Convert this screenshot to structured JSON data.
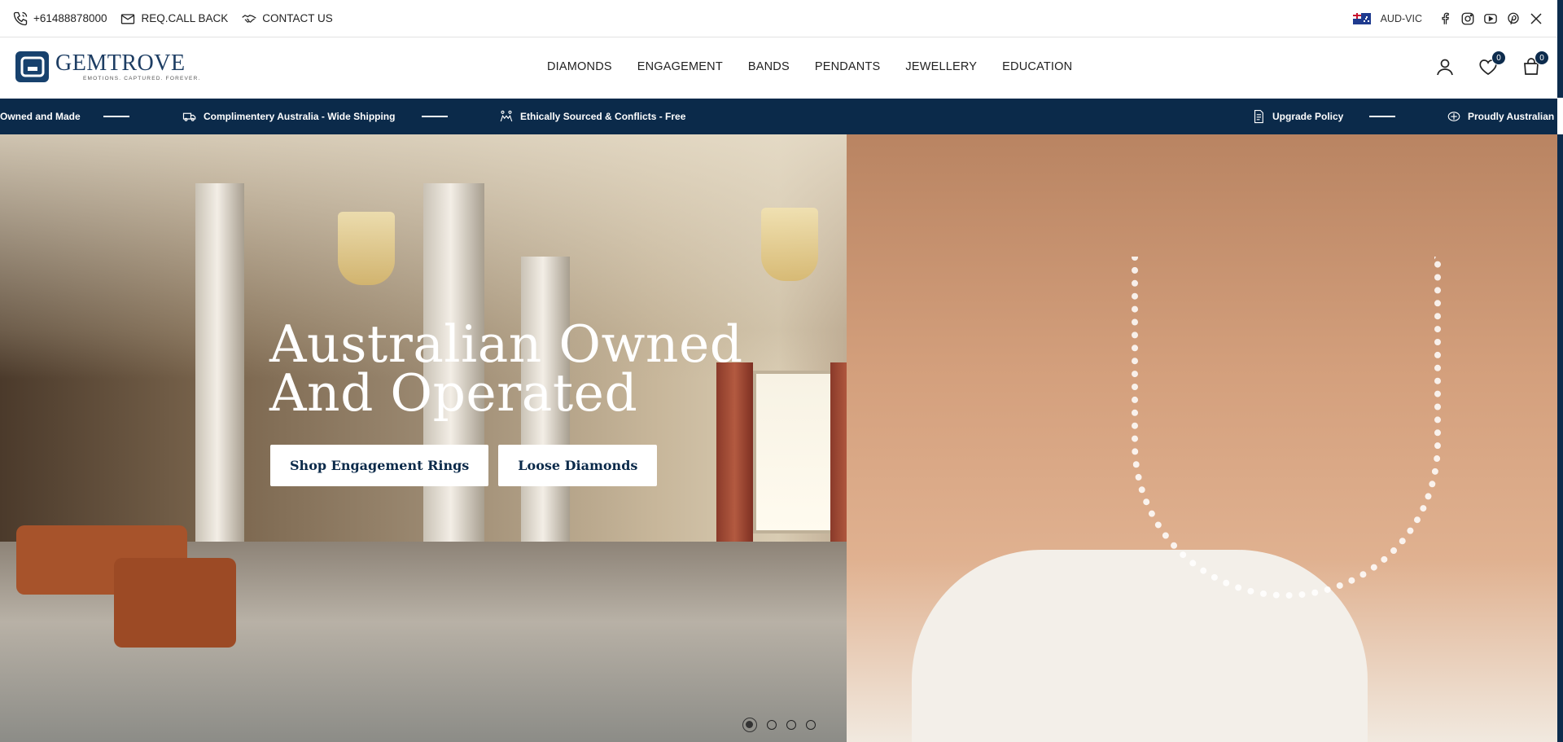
{
  "topbar": {
    "phone": "+61488878000",
    "callback": "REQ.CALL BACK",
    "contact": "CONTACT US",
    "currency": "AUD-VIC",
    "social": [
      "facebook-icon",
      "instagram-icon",
      "youtube-icon",
      "pinterest-icon",
      "x-icon"
    ]
  },
  "header": {
    "logo_name": "GEMTROVE",
    "logo_tag": "EMOTIONS. CAPTURED. FOREVER.",
    "nav": [
      "DIAMONDS",
      "ENGAGEMENT",
      "BANDS",
      "PENDANTS",
      "JEWELLERY",
      "EDUCATION"
    ],
    "wishlist_count": "0",
    "cart_count": "0"
  },
  "ticker": {
    "items": [
      "Owned and Made",
      "Complimentery Australia - Wide Shipping",
      "Ethically Sourced & Conflicts - Free",
      "Upgrade Policy",
      "Proudly Australian O"
    ]
  },
  "hero": {
    "title_line1": "Australian Owned",
    "title_line2": "And Operated",
    "btn_rings": "Shop Engagement Rings",
    "btn_diamonds": "Loose Diamonds",
    "slides_total": 4,
    "slide_active": 1
  },
  "colors": {
    "brand_navy": "#0b2a4a",
    "logo_blue": "#17416d"
  }
}
